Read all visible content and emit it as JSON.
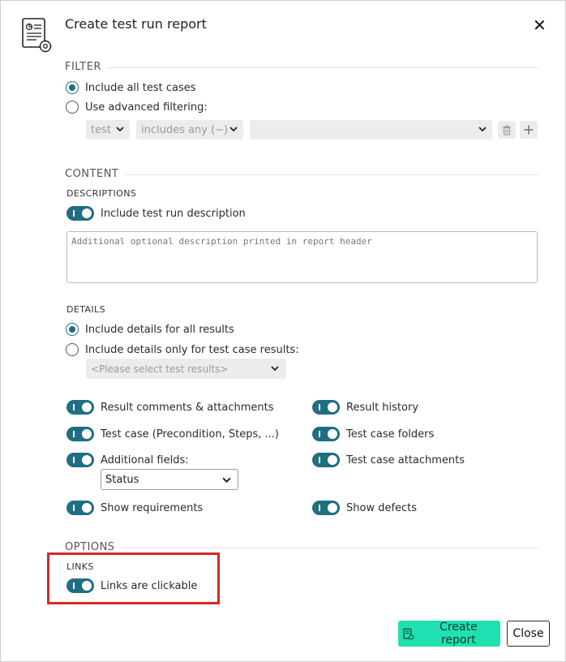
{
  "dialog": {
    "title": "Create test run report",
    "close_label": "✕"
  },
  "filter": {
    "section_title": "FILTER",
    "option_all": "Include all test cases",
    "option_advanced": "Use advanced filtering:",
    "field_select": "test",
    "operator_select": "includes any  (~)",
    "value_select": ""
  },
  "content": {
    "section_title": "CONTENT",
    "descriptions_title": "DESCRIPTIONS",
    "include_description": "Include test run description",
    "description_placeholder": "Additional optional description printed in report header",
    "details_title": "DETAILS",
    "details_all": "Include details for all results",
    "details_only": "Include details only for test case results:",
    "results_placeholder": "<Please select test results>",
    "toggles_left": [
      "Result comments & attachments",
      "Test case (Precondition, Steps, ...)",
      "Additional fields:",
      "Show requirements"
    ],
    "toggles_right": [
      "Result history",
      "Test case folders",
      "Test case attachments",
      "Show defects"
    ],
    "additional_fields_value": "Status"
  },
  "options": {
    "section_title": "OPTIONS",
    "links_title": "LINKS",
    "links_clickable": "Links are clickable"
  },
  "footer": {
    "create_label": "Create report",
    "close_label": "Close"
  },
  "colors": {
    "toggle": "#1f6e82",
    "primary": "#1fe0b0",
    "highlight": "#d62828"
  }
}
